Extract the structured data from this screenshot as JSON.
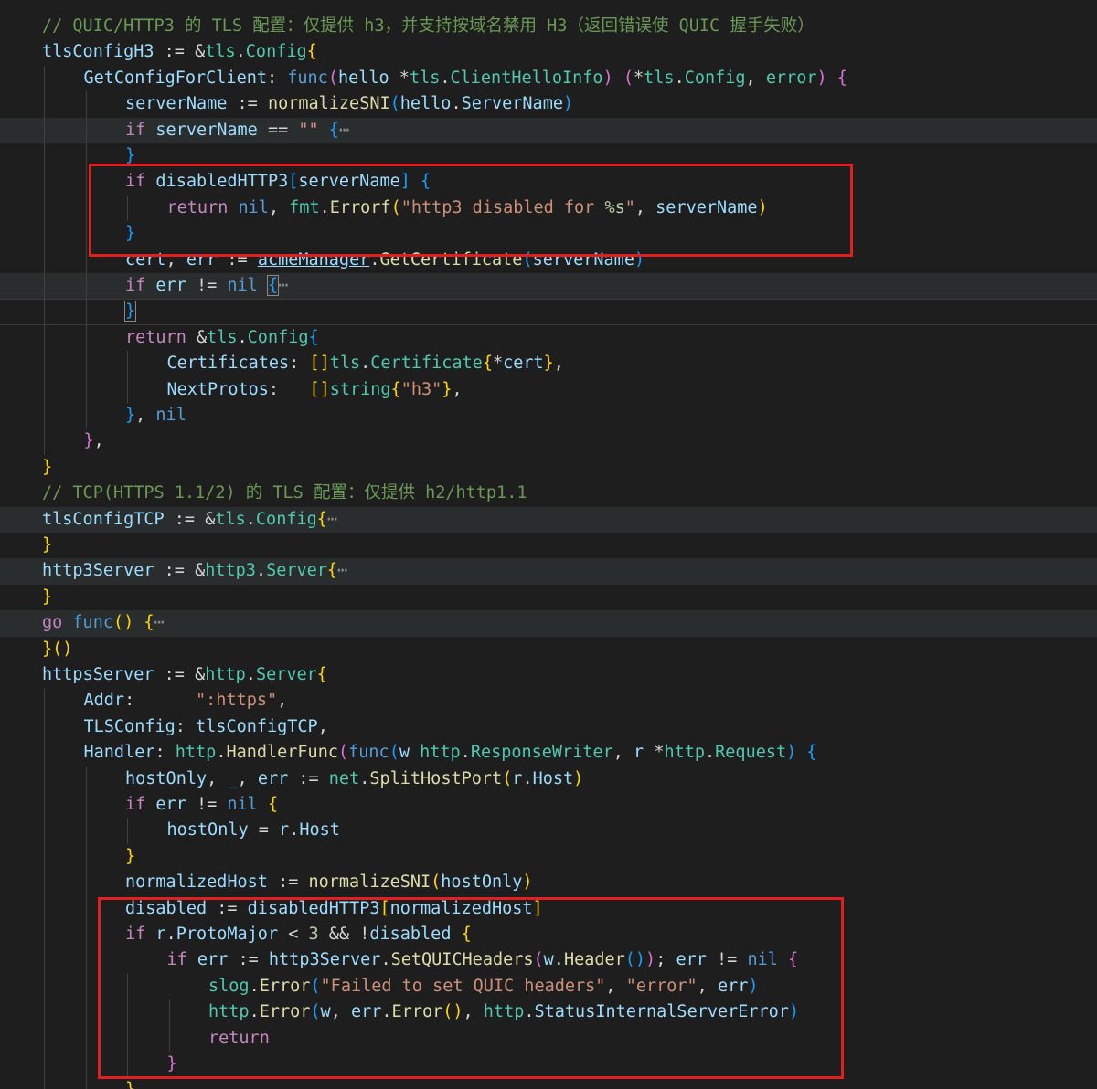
{
  "editor": {
    "language": "go",
    "theme": "dark",
    "colors": {
      "background": "#1e1e1e",
      "comment": "#6a9955",
      "keyword": "#569cd6",
      "control": "#c586c0",
      "type": "#4ec9b0",
      "function": "#dcdcaa",
      "string": "#ce9178",
      "variable": "#9cdcfe",
      "highlight_box": "#e02020"
    },
    "lines": [
      [
        [
          "// QUIC/HTTP3 的 TLS 配置：仅提供 h3，并支持按域名禁用 H3（返回错误使 QUIC 握手失败）",
          "c"
        ]
      ],
      [
        [
          "tlsConfigH3",
          "v"
        ],
        [
          " := &",
          "o"
        ],
        [
          "tls",
          "t"
        ],
        [
          ".",
          "o"
        ],
        [
          "Config",
          "t"
        ],
        [
          "{",
          "b1"
        ]
      ],
      [
        [
          "GetConfigForClient",
          "v"
        ],
        [
          ": ",
          "o"
        ],
        [
          "func",
          "k"
        ],
        [
          "(",
          "b2"
        ],
        [
          "hello ",
          "v"
        ],
        [
          "*",
          "o"
        ],
        [
          "tls",
          "t"
        ],
        [
          ".",
          "o"
        ],
        [
          "ClientHelloInfo",
          "t"
        ],
        [
          ")",
          "b2"
        ],
        [
          " ",
          "o"
        ],
        [
          "(",
          "b2"
        ],
        [
          "*",
          "o"
        ],
        [
          "tls",
          "t"
        ],
        [
          ".",
          "o"
        ],
        [
          "Config",
          "t"
        ],
        [
          ", ",
          "o"
        ],
        [
          "error",
          "t"
        ],
        [
          ")",
          "b2"
        ],
        [
          " ",
          "o"
        ],
        [
          "{",
          "b2"
        ]
      ],
      [
        [
          "serverName",
          "v"
        ],
        [
          " := ",
          "o"
        ],
        [
          "normalizeSNI",
          "f"
        ],
        [
          "(",
          "b3"
        ],
        [
          "hello",
          "v"
        ],
        [
          ".",
          "o"
        ],
        [
          "ServerName",
          "v"
        ],
        [
          ")",
          "b3"
        ]
      ],
      [
        [
          "if",
          "ctl"
        ],
        [
          " ",
          "o"
        ],
        [
          "serverName",
          "v"
        ],
        [
          " == ",
          "o"
        ],
        [
          "\"\"",
          "s"
        ],
        [
          " ",
          "o"
        ],
        [
          "{",
          "b3"
        ],
        [
          "⋯",
          "fold"
        ]
      ],
      [
        [
          "}",
          "b3"
        ]
      ],
      [
        [
          "if",
          "ctl"
        ],
        [
          " ",
          "o"
        ],
        [
          "disabledHTTP3",
          "v"
        ],
        [
          "[",
          "b3"
        ],
        [
          "serverName",
          "v"
        ],
        [
          "]",
          "b3"
        ],
        [
          " ",
          "o"
        ],
        [
          "{",
          "b3"
        ]
      ],
      [
        [
          "return",
          "ctl"
        ],
        [
          " ",
          "o"
        ],
        [
          "nil",
          "k"
        ],
        [
          ", ",
          "o"
        ],
        [
          "fmt",
          "t"
        ],
        [
          ".",
          "o"
        ],
        [
          "Errorf",
          "f"
        ],
        [
          "(",
          "b1"
        ],
        [
          "\"http3 disabled for ",
          "s"
        ],
        [
          "%s",
          "n"
        ],
        [
          "\"",
          "s"
        ],
        [
          ", ",
          "o"
        ],
        [
          "serverName",
          "v"
        ],
        [
          ")",
          "b1"
        ]
      ],
      [
        [
          "}",
          "b3"
        ]
      ],
      [
        [
          "cert",
          "v"
        ],
        [
          ", ",
          "o"
        ],
        [
          "err",
          "v"
        ],
        [
          " := ",
          "o"
        ],
        [
          "acmeManager",
          "v u"
        ],
        [
          ".",
          "o"
        ],
        [
          "GetCertificate",
          "f"
        ],
        [
          "(",
          "b3"
        ],
        [
          "serverName",
          "v"
        ],
        [
          ")",
          "b3"
        ]
      ],
      [
        [
          "if",
          "ctl"
        ],
        [
          " ",
          "o"
        ],
        [
          "err",
          "v"
        ],
        [
          " != ",
          "o"
        ],
        [
          "nil",
          "k"
        ],
        [
          " ",
          "o"
        ],
        [
          "{",
          "b3 bm"
        ],
        [
          "⋯",
          "fold"
        ]
      ],
      [
        [
          "}",
          "b3 bm"
        ]
      ],
      [
        [
          "return",
          "ctl"
        ],
        [
          " &",
          "o"
        ],
        [
          "tls",
          "t"
        ],
        [
          ".",
          "o"
        ],
        [
          "Config",
          "t"
        ],
        [
          "{",
          "b3"
        ]
      ],
      [
        [
          "Certificates",
          "v"
        ],
        [
          ": ",
          "o"
        ],
        [
          "[]",
          "b1"
        ],
        [
          "tls",
          "t"
        ],
        [
          ".",
          "o"
        ],
        [
          "Certificate",
          "t"
        ],
        [
          "{",
          "b1"
        ],
        [
          "*",
          "o"
        ],
        [
          "cert",
          "v"
        ],
        [
          "}",
          "b1"
        ],
        [
          ",",
          "o"
        ]
      ],
      [
        [
          "NextProtos",
          "v"
        ],
        [
          ":   ",
          "o"
        ],
        [
          "[]",
          "b1"
        ],
        [
          "string",
          "t"
        ],
        [
          "{",
          "b1"
        ],
        [
          "\"h3\"",
          "s"
        ],
        [
          "}",
          "b1"
        ],
        [
          ",",
          "o"
        ]
      ],
      [
        [
          "}",
          "b3"
        ],
        [
          ", ",
          "o"
        ],
        [
          "nil",
          "k"
        ]
      ],
      [
        [
          "}",
          "b2"
        ],
        [
          ",",
          "o"
        ]
      ],
      [
        [
          "}",
          "b1"
        ]
      ],
      [
        [
          "// TCP(HTTPS 1.1/2) 的 TLS 配置：仅提供 h2/http1.1",
          "c"
        ]
      ],
      [
        [
          "tlsConfigTCP",
          "v"
        ],
        [
          " := &",
          "o"
        ],
        [
          "tls",
          "t"
        ],
        [
          ".",
          "o"
        ],
        [
          "Config",
          "t"
        ],
        [
          "{",
          "b1"
        ],
        [
          "⋯",
          "fold"
        ]
      ],
      [
        [
          "}",
          "b1"
        ]
      ],
      [
        [
          "http3Server",
          "v"
        ],
        [
          " := &",
          "o"
        ],
        [
          "http3",
          "t"
        ],
        [
          ".",
          "o"
        ],
        [
          "Server",
          "t"
        ],
        [
          "{",
          "b1"
        ],
        [
          "⋯",
          "fold"
        ]
      ],
      [
        [
          "}",
          "b1"
        ]
      ],
      [
        [
          "go",
          "ctl"
        ],
        [
          " ",
          "o"
        ],
        [
          "func",
          "k"
        ],
        [
          "()",
          "b1"
        ],
        [
          " ",
          "o"
        ],
        [
          "{",
          "b1"
        ],
        [
          "⋯",
          "fold"
        ]
      ],
      [
        [
          "}",
          "b1"
        ],
        [
          "()",
          "b1"
        ]
      ],
      [
        [
          "httpsServer",
          "v"
        ],
        [
          " := &",
          "o"
        ],
        [
          "http",
          "t"
        ],
        [
          ".",
          "o"
        ],
        [
          "Server",
          "t"
        ],
        [
          "{",
          "b1"
        ]
      ],
      [
        [
          "Addr",
          "v"
        ],
        [
          ":      ",
          "o"
        ],
        [
          "\":https\"",
          "s"
        ],
        [
          ",",
          "o"
        ]
      ],
      [
        [
          "TLSConfig",
          "v"
        ],
        [
          ": ",
          "o"
        ],
        [
          "tlsConfigTCP",
          "v"
        ],
        [
          ",",
          "o"
        ]
      ],
      [
        [
          "Handler",
          "v"
        ],
        [
          ": ",
          "o"
        ],
        [
          "http",
          "t"
        ],
        [
          ".",
          "o"
        ],
        [
          "HandlerFunc",
          "f"
        ],
        [
          "(",
          "b2"
        ],
        [
          "func",
          "k"
        ],
        [
          "(",
          "b3"
        ],
        [
          "w ",
          "v"
        ],
        [
          "http",
          "t"
        ],
        [
          ".",
          "o"
        ],
        [
          "ResponseWriter",
          "t"
        ],
        [
          ", ",
          "o"
        ],
        [
          "r ",
          "v"
        ],
        [
          "*",
          "o"
        ],
        [
          "http",
          "t"
        ],
        [
          ".",
          "o"
        ],
        [
          "Request",
          "t"
        ],
        [
          ")",
          "b3"
        ],
        [
          " ",
          "o"
        ],
        [
          "{",
          "b3"
        ]
      ],
      [
        [
          "hostOnly",
          "v"
        ],
        [
          ", ",
          "o"
        ],
        [
          "_",
          "v"
        ],
        [
          ", ",
          "o"
        ],
        [
          "err",
          "v"
        ],
        [
          " := ",
          "o"
        ],
        [
          "net",
          "t"
        ],
        [
          ".",
          "o"
        ],
        [
          "SplitHostPort",
          "f"
        ],
        [
          "(",
          "b1"
        ],
        [
          "r",
          "v"
        ],
        [
          ".",
          "o"
        ],
        [
          "Host",
          "v"
        ],
        [
          ")",
          "b1"
        ]
      ],
      [
        [
          "if",
          "ctl"
        ],
        [
          " ",
          "o"
        ],
        [
          "err",
          "v"
        ],
        [
          " != ",
          "o"
        ],
        [
          "nil",
          "k"
        ],
        [
          " ",
          "o"
        ],
        [
          "{",
          "b1"
        ]
      ],
      [
        [
          "hostOnly",
          "v"
        ],
        [
          " = ",
          "o"
        ],
        [
          "r",
          "v"
        ],
        [
          ".",
          "o"
        ],
        [
          "Host",
          "v"
        ]
      ],
      [
        [
          "}",
          "b1"
        ]
      ],
      [
        [
          "normalizedHost",
          "v"
        ],
        [
          " := ",
          "o"
        ],
        [
          "normalizeSNI",
          "f"
        ],
        [
          "(",
          "b1"
        ],
        [
          "hostOnly",
          "v"
        ],
        [
          ")",
          "b1"
        ]
      ],
      [
        [
          "disabled",
          "v"
        ],
        [
          " := ",
          "o"
        ],
        [
          "disabledHTTP3",
          "v"
        ],
        [
          "[",
          "b1"
        ],
        [
          "normalizedHost",
          "v"
        ],
        [
          "]",
          "b1"
        ]
      ],
      [
        [
          "if",
          "ctl"
        ],
        [
          " ",
          "o"
        ],
        [
          "r",
          "v"
        ],
        [
          ".",
          "o"
        ],
        [
          "ProtoMajor",
          "v"
        ],
        [
          " < ",
          "o"
        ],
        [
          "3",
          "n"
        ],
        [
          " && !",
          "o"
        ],
        [
          "disabled",
          "v"
        ],
        [
          " ",
          "o"
        ],
        [
          "{",
          "b1"
        ]
      ],
      [
        [
          "if",
          "ctl"
        ],
        [
          " ",
          "o"
        ],
        [
          "err",
          "v"
        ],
        [
          " := ",
          "o"
        ],
        [
          "http3Server",
          "v"
        ],
        [
          ".",
          "o"
        ],
        [
          "SetQUICHeaders",
          "f"
        ],
        [
          "(",
          "b2"
        ],
        [
          "w",
          "v"
        ],
        [
          ".",
          "o"
        ],
        [
          "Header",
          "f"
        ],
        [
          "()",
          "b3"
        ],
        [
          ")",
          "b2"
        ],
        [
          "; ",
          "o"
        ],
        [
          "err",
          "v"
        ],
        [
          " != ",
          "o"
        ],
        [
          "nil",
          "k"
        ],
        [
          " ",
          "o"
        ],
        [
          "{",
          "b2"
        ]
      ],
      [
        [
          "slog",
          "t"
        ],
        [
          ".",
          "o"
        ],
        [
          "Error",
          "f"
        ],
        [
          "(",
          "b3"
        ],
        [
          "\"Failed to set QUIC headers\"",
          "s"
        ],
        [
          ", ",
          "o"
        ],
        [
          "\"error\"",
          "s"
        ],
        [
          ", ",
          "o"
        ],
        [
          "err",
          "v"
        ],
        [
          ")",
          "b3"
        ]
      ],
      [
        [
          "http",
          "t"
        ],
        [
          ".",
          "o"
        ],
        [
          "Error",
          "f"
        ],
        [
          "(",
          "b3"
        ],
        [
          "w",
          "v"
        ],
        [
          ", ",
          "o"
        ],
        [
          "err",
          "v"
        ],
        [
          ".",
          "o"
        ],
        [
          "Error",
          "f"
        ],
        [
          "()",
          "b1"
        ],
        [
          ", ",
          "o"
        ],
        [
          "http",
          "t"
        ],
        [
          ".",
          "o"
        ],
        [
          "StatusInternalServerError",
          "v"
        ],
        [
          ")",
          "b3"
        ]
      ],
      [
        [
          "return",
          "ctl"
        ]
      ],
      [
        [
          "}",
          "b2"
        ]
      ],
      [
        [
          "}",
          "b1"
        ]
      ]
    ]
  }
}
